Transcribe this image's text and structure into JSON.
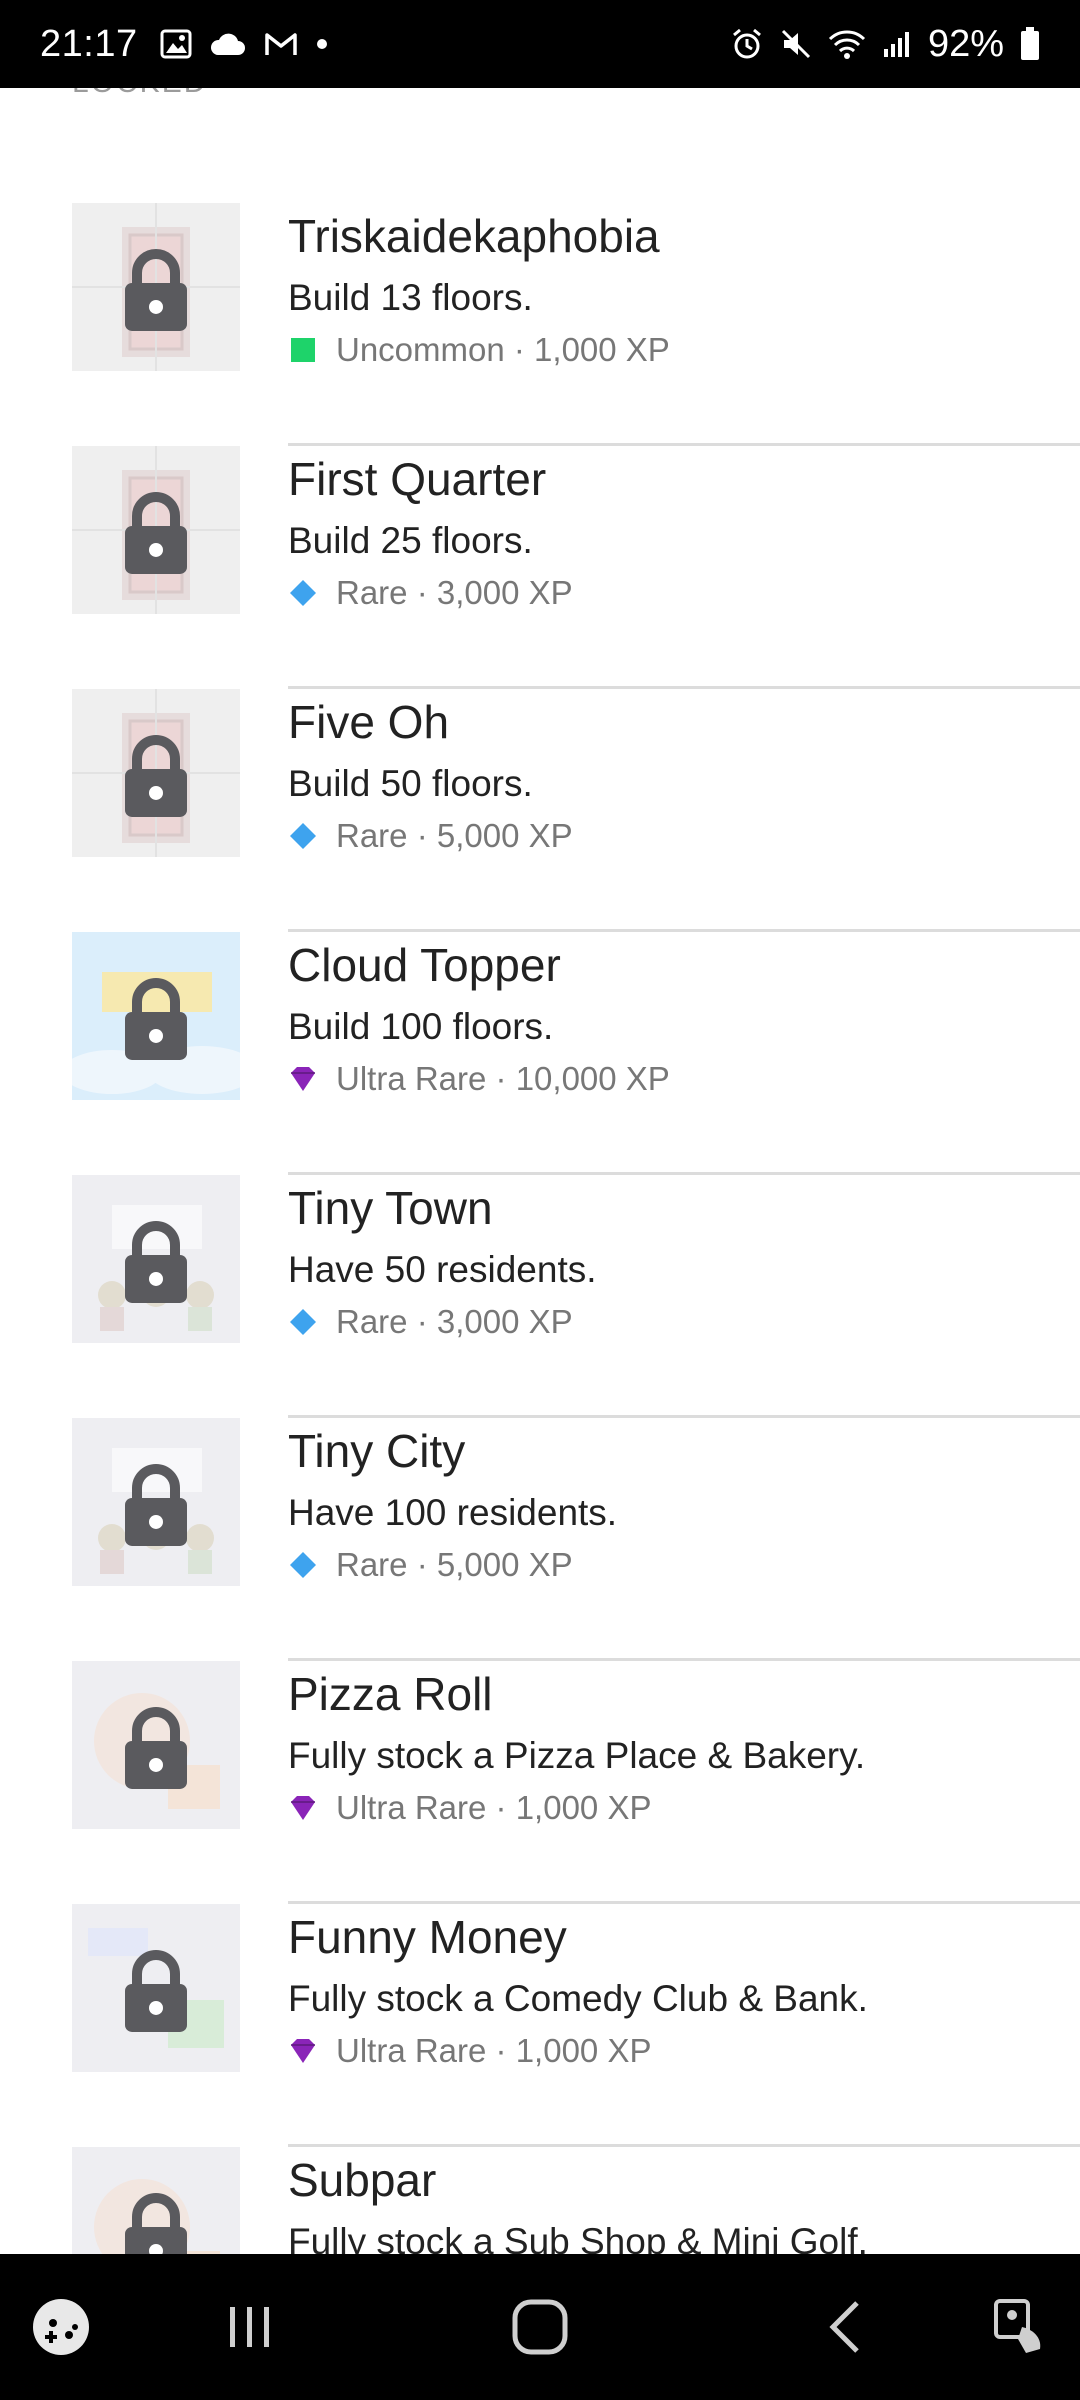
{
  "status_bar": {
    "time": "21:17",
    "battery": "92%",
    "icons_left": [
      "gallery-icon",
      "cloud-icon",
      "gmail-icon",
      "dot-icon"
    ],
    "icons_right": [
      "alarm-icon",
      "mute-icon",
      "wifi-icon",
      "signal-icon",
      "battery-icon"
    ]
  },
  "section": {
    "label": "LOCKED"
  },
  "achievements": [
    {
      "title": "Triskaidekaphobia",
      "description": "Build 13 floors.",
      "rarity": "Uncommon",
      "xp": "1,000 XP",
      "meta": "Uncommon · 1,000 XP",
      "rarity_icon": "square",
      "rarity_color": "#1ed36a",
      "art": "tower"
    },
    {
      "title": "First Quarter",
      "description": "Build 25 floors.",
      "rarity": "Rare",
      "xp": "3,000 XP",
      "meta": "Rare · 3,000 XP",
      "rarity_icon": "diamond",
      "rarity_color": "#3ea3ee",
      "art": "tower"
    },
    {
      "title": "Five Oh",
      "description": "Build 50 floors.",
      "rarity": "Rare",
      "xp": "5,000 XP",
      "meta": "Rare · 5,000 XP",
      "rarity_icon": "diamond",
      "rarity_color": "#3ea3ee",
      "art": "tower"
    },
    {
      "title": "Cloud Topper",
      "description": "Build 100 floors.",
      "rarity": "Ultra Rare",
      "xp": "10,000 XP",
      "meta": "Ultra Rare · 10,000 XP",
      "rarity_icon": "gem",
      "rarity_color": "#8a24b8",
      "art": "sky"
    },
    {
      "title": "Tiny Town",
      "description": "Have 50 residents.",
      "rarity": "Rare",
      "xp": "3,000 XP",
      "meta": "Rare · 3,000 XP",
      "rarity_icon": "diamond",
      "rarity_color": "#3ea3ee",
      "art": "people"
    },
    {
      "title": "Tiny City",
      "description": "Have 100 residents.",
      "rarity": "Rare",
      "xp": "5,000 XP",
      "meta": "Rare · 5,000 XP",
      "rarity_icon": "diamond",
      "rarity_color": "#3ea3ee",
      "art": "people"
    },
    {
      "title": "Pizza Roll",
      "description": "Fully stock a Pizza Place & Bakery.",
      "rarity": "Ultra Rare",
      "xp": "1,000 XP",
      "meta": "Ultra Rare · 1,000 XP",
      "rarity_icon": "gem",
      "rarity_color": "#8a24b8",
      "art": "food"
    },
    {
      "title": "Funny Money",
      "description": "Fully stock a Comedy Club & Bank.",
      "rarity": "Ultra Rare",
      "xp": "1,000 XP",
      "meta": "Ultra Rare · 1,000 XP",
      "rarity_icon": "gem",
      "rarity_color": "#8a24b8",
      "art": "money"
    },
    {
      "title": "Subpar",
      "description": "Fully stock a Sub Shop & Mini Golf.",
      "rarity": "",
      "xp": "",
      "meta": "",
      "rarity_icon": "",
      "rarity_color": "#3ea3ee",
      "art": "food"
    }
  ],
  "nav_bar": {
    "buttons": [
      "game-launcher-icon",
      "recents-icon",
      "home-icon",
      "back-icon",
      "accessibility-icon"
    ]
  }
}
